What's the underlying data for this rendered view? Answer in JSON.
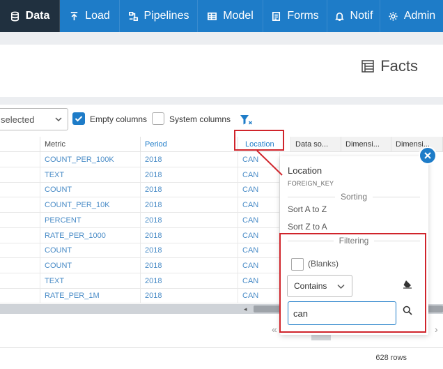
{
  "nav": {
    "items": [
      {
        "label": "Data",
        "icon": "database-icon"
      },
      {
        "label": "Load",
        "icon": "upload-icon"
      },
      {
        "label": "Pipelines",
        "icon": "pipelines-icon"
      },
      {
        "label": "Model",
        "icon": "table-icon"
      },
      {
        "label": "Forms",
        "icon": "forms-icon"
      },
      {
        "label": "Notif",
        "icon": "bell-icon"
      },
      {
        "label": "Admin",
        "icon": "gear-icon"
      }
    ],
    "active": "Data",
    "color": "#1e7cc8",
    "active_color": "#20303f"
  },
  "header": {
    "title": "Facts",
    "icon": "table-list-icon"
  },
  "toolbar": {
    "select_value": "selected",
    "empty_columns_label": "Empty columns",
    "empty_columns_checked": true,
    "system_columns_label": "System columns",
    "system_columns_checked": false,
    "filter_icon": "filter-clear-icon"
  },
  "table": {
    "columns": [
      "Metric",
      "Period",
      "Location",
      "Data so...",
      "Dimensi...",
      "Dimensi..."
    ],
    "rows": [
      [
        "COUNT_PER_100K",
        "2018",
        "CAN"
      ],
      [
        "TEXT",
        "2018",
        "CAN"
      ],
      [
        "COUNT",
        "2018",
        "CAN"
      ],
      [
        "COUNT_PER_10K",
        "2018",
        "CAN"
      ],
      [
        "PERCENT",
        "2018",
        "CAN"
      ],
      [
        "RATE_PER_1000",
        "2018",
        "CAN"
      ],
      [
        "COUNT",
        "2018",
        "CAN"
      ],
      [
        "COUNT",
        "2018",
        "CAN"
      ],
      [
        "TEXT",
        "2018",
        "CAN"
      ],
      [
        "RATE_PER_1M",
        "2018",
        "CAN"
      ]
    ]
  },
  "pager": {
    "prev": "«",
    "next": "›"
  },
  "footer": {
    "row_count": "628 rows"
  },
  "popup": {
    "title": "Location",
    "subtitle": "FOREIGN_KEY",
    "sorting_label": "Sorting",
    "sort_az": "Sort A to Z",
    "sort_za": "Sort Z to A",
    "filtering_label": "Filtering",
    "blanks_label": "(Blanks)",
    "blanks_checked": false,
    "match_mode": "Contains",
    "search_value": "can",
    "highlight_color": "#d0242b"
  }
}
